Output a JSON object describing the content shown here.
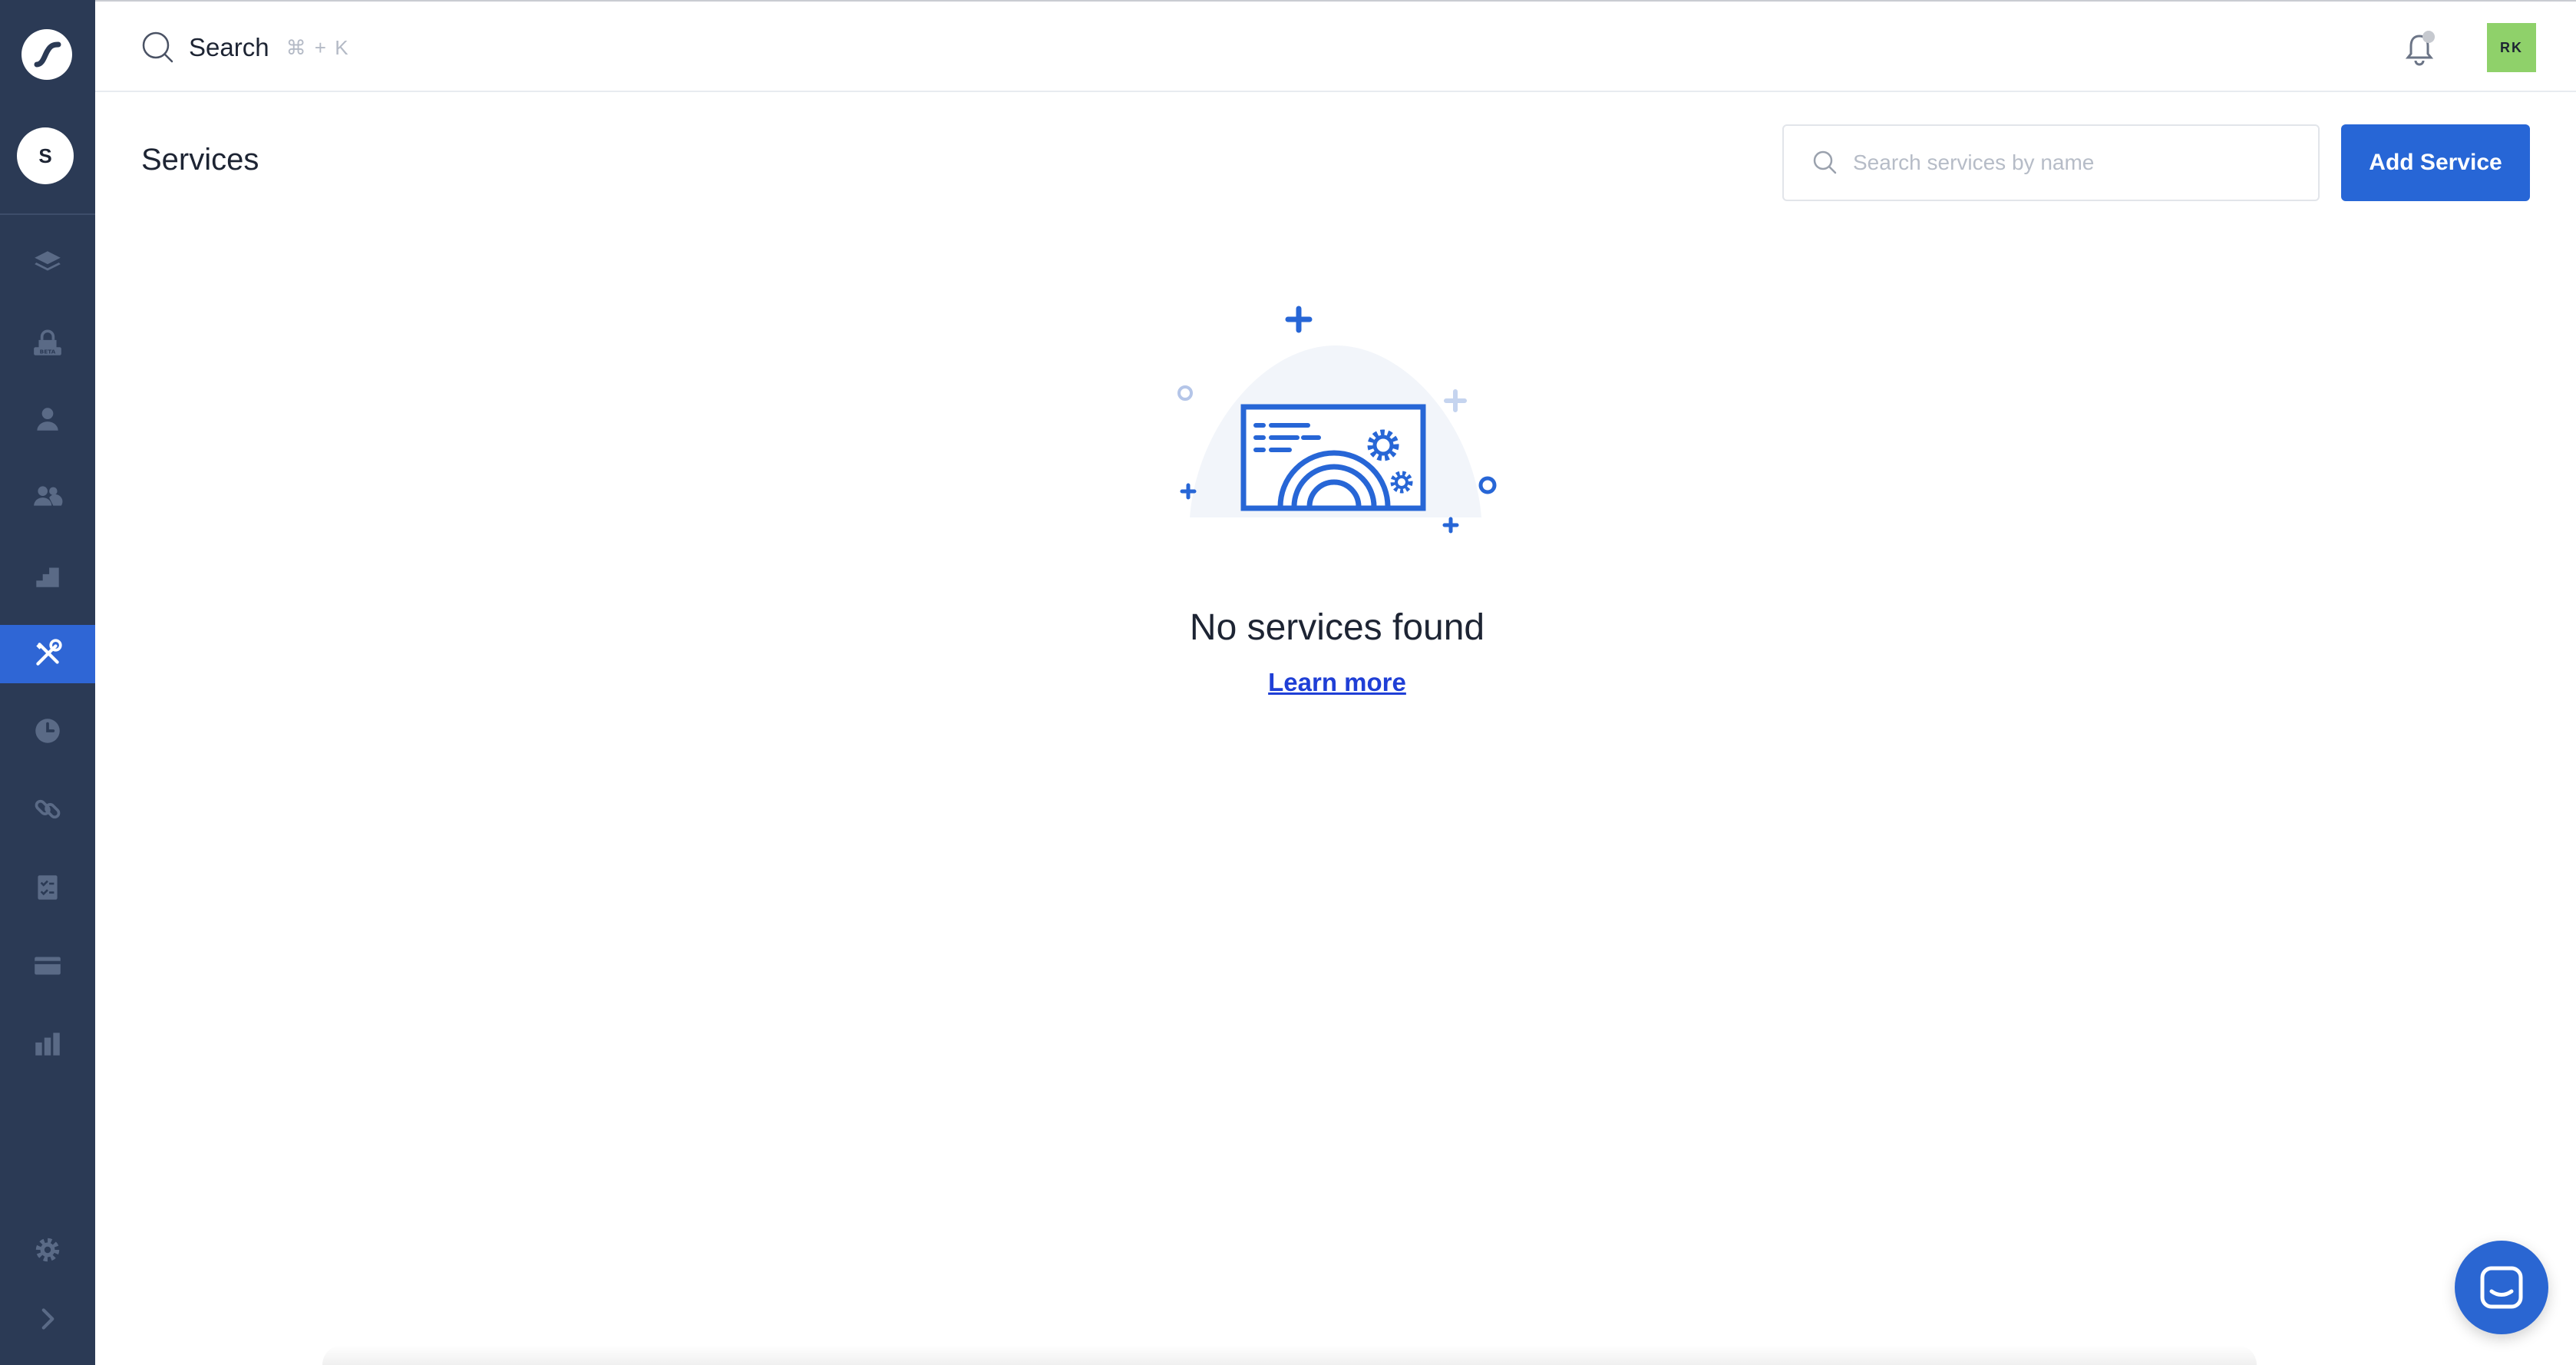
{
  "sidebar": {
    "account_initial": "S",
    "nav_items": [
      {
        "icon": "layers-icon"
      },
      {
        "icon": "beta-lock-icon"
      },
      {
        "icon": "user-icon"
      },
      {
        "icon": "users-icon"
      },
      {
        "icon": "stairs-icon"
      },
      {
        "icon": "tools-icon",
        "active": true
      },
      {
        "icon": "clock-icon"
      },
      {
        "icon": "link-icon"
      },
      {
        "icon": "checklist-icon"
      },
      {
        "icon": "card-icon"
      },
      {
        "icon": "bar-chart-icon"
      }
    ],
    "settings_icon": "gear-icon",
    "expand_icon": "chevron-right-icon"
  },
  "topbar": {
    "search_label": "Search",
    "search_shortcut": "⌘ + K",
    "user_initials": "RK"
  },
  "page": {
    "title": "Services",
    "search_placeholder": "Search services by name",
    "add_button": "Add Service"
  },
  "empty_state": {
    "title": "No services found",
    "link": "Learn more"
  },
  "colors": {
    "sidebar_bg": "#2b3a55",
    "accent": "#2766d6",
    "avatar_bg": "#8fd16a"
  }
}
